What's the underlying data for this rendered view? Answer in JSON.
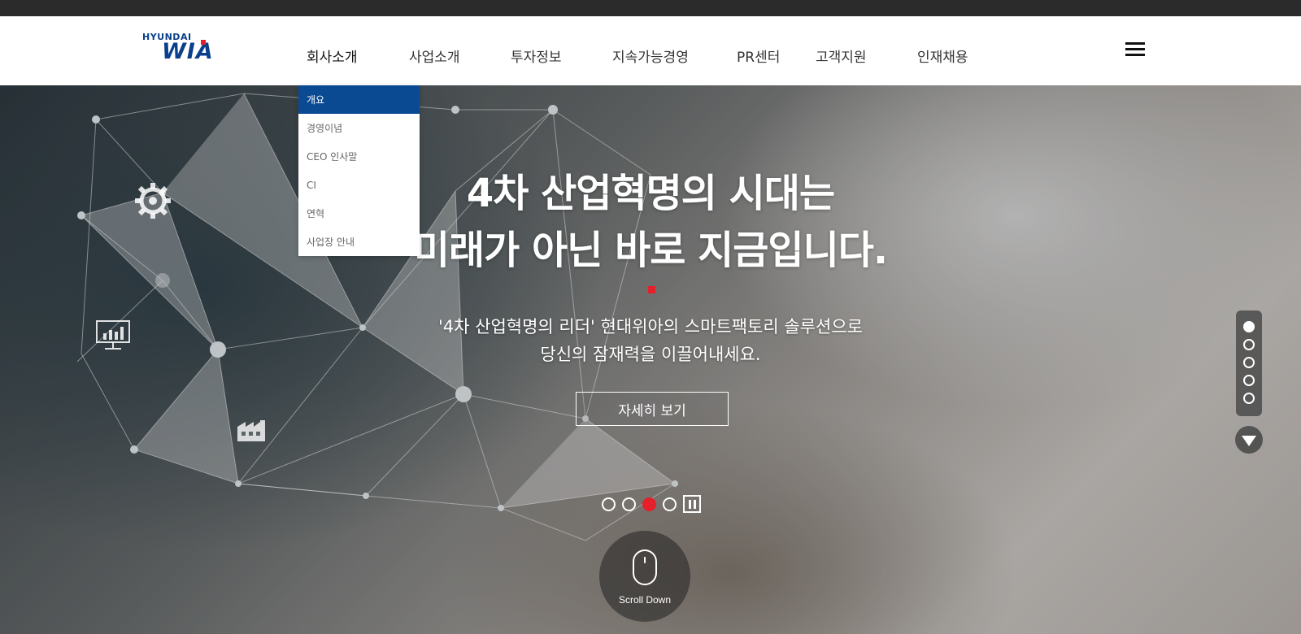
{
  "header": {
    "logo_small": "HYUNDAI",
    "logo_big": "WIA",
    "nav": [
      "회사소개",
      "사업소개",
      "투자정보",
      "지속가능경영",
      "PR센터",
      "고객지원",
      "인재채용"
    ],
    "menu_icon": "hamburger-icon"
  },
  "dropdown": {
    "items": [
      "개요",
      "경영이념",
      "CEO 인사말",
      "CI",
      "연혁",
      "사업장 안내"
    ],
    "active_index": 0
  },
  "hero": {
    "title_line1": "4차 산업혁명의 시대는",
    "title_line2": "미래가 아닌 바로 지금입니다.",
    "subtitle_line1": "'4차 산업혁명의 리더' 현대위아의 스마트팩토리 솔루션으로",
    "subtitle_line2": "당신의 잠재력을 이끌어내세요.",
    "button_label": "자세히 보기",
    "slide_count": 4,
    "active_slide": 3,
    "scroll_label": "Scroll Down"
  },
  "side_nav": {
    "section_count": 5,
    "active_section": 1
  },
  "colors": {
    "brand_blue": "#0a3f8c",
    "accent_red": "#e5202b",
    "dropdown_active": "#0a4a93",
    "topbar": "#2b2b2b"
  }
}
